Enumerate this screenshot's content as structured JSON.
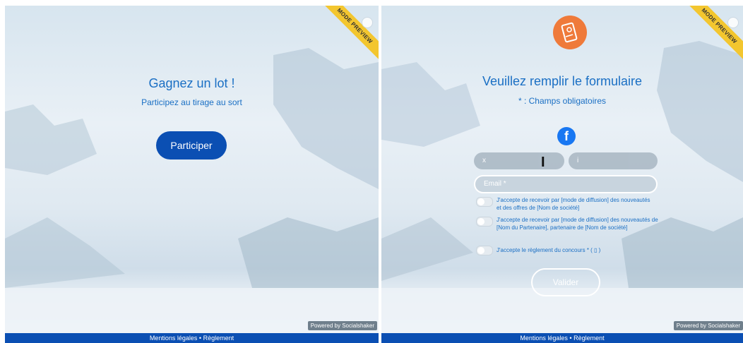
{
  "left": {
    "ribbon": "MODE PREVIEW",
    "title": "Gagnez un lot !",
    "subtitle": "Participez au tirage au sort",
    "button": "Participer",
    "powered": "Powered by Socialshaker",
    "footer": {
      "mentions": "Mentions légales",
      "sep": " • ",
      "reglement": "Règlement"
    }
  },
  "right": {
    "ribbon": "MODE PREVIEW",
    "title": "Veuillez remplir le formulaire",
    "subtitle": "* : Champs obligatoires",
    "facebook": "f",
    "field1": "x",
    "field2": "i",
    "email": "Email *",
    "consents": [
      "J'accepte de recevoir par [mode de diffusion] des nouveautés et des offres de [Nom de société]",
      "J'accepte de recevoir par [mode de diffusion] des nouveautés de [Nom du Partenaire], partenaire de [Nom de société]",
      "J'accepte le règlement du concours * ( ▯ )"
    ],
    "submit": "Valider",
    "powered": "Powered by Socialshaker",
    "footer": {
      "mentions": "Mentions légales",
      "sep": " • ",
      "reglement": "Règlement"
    }
  }
}
